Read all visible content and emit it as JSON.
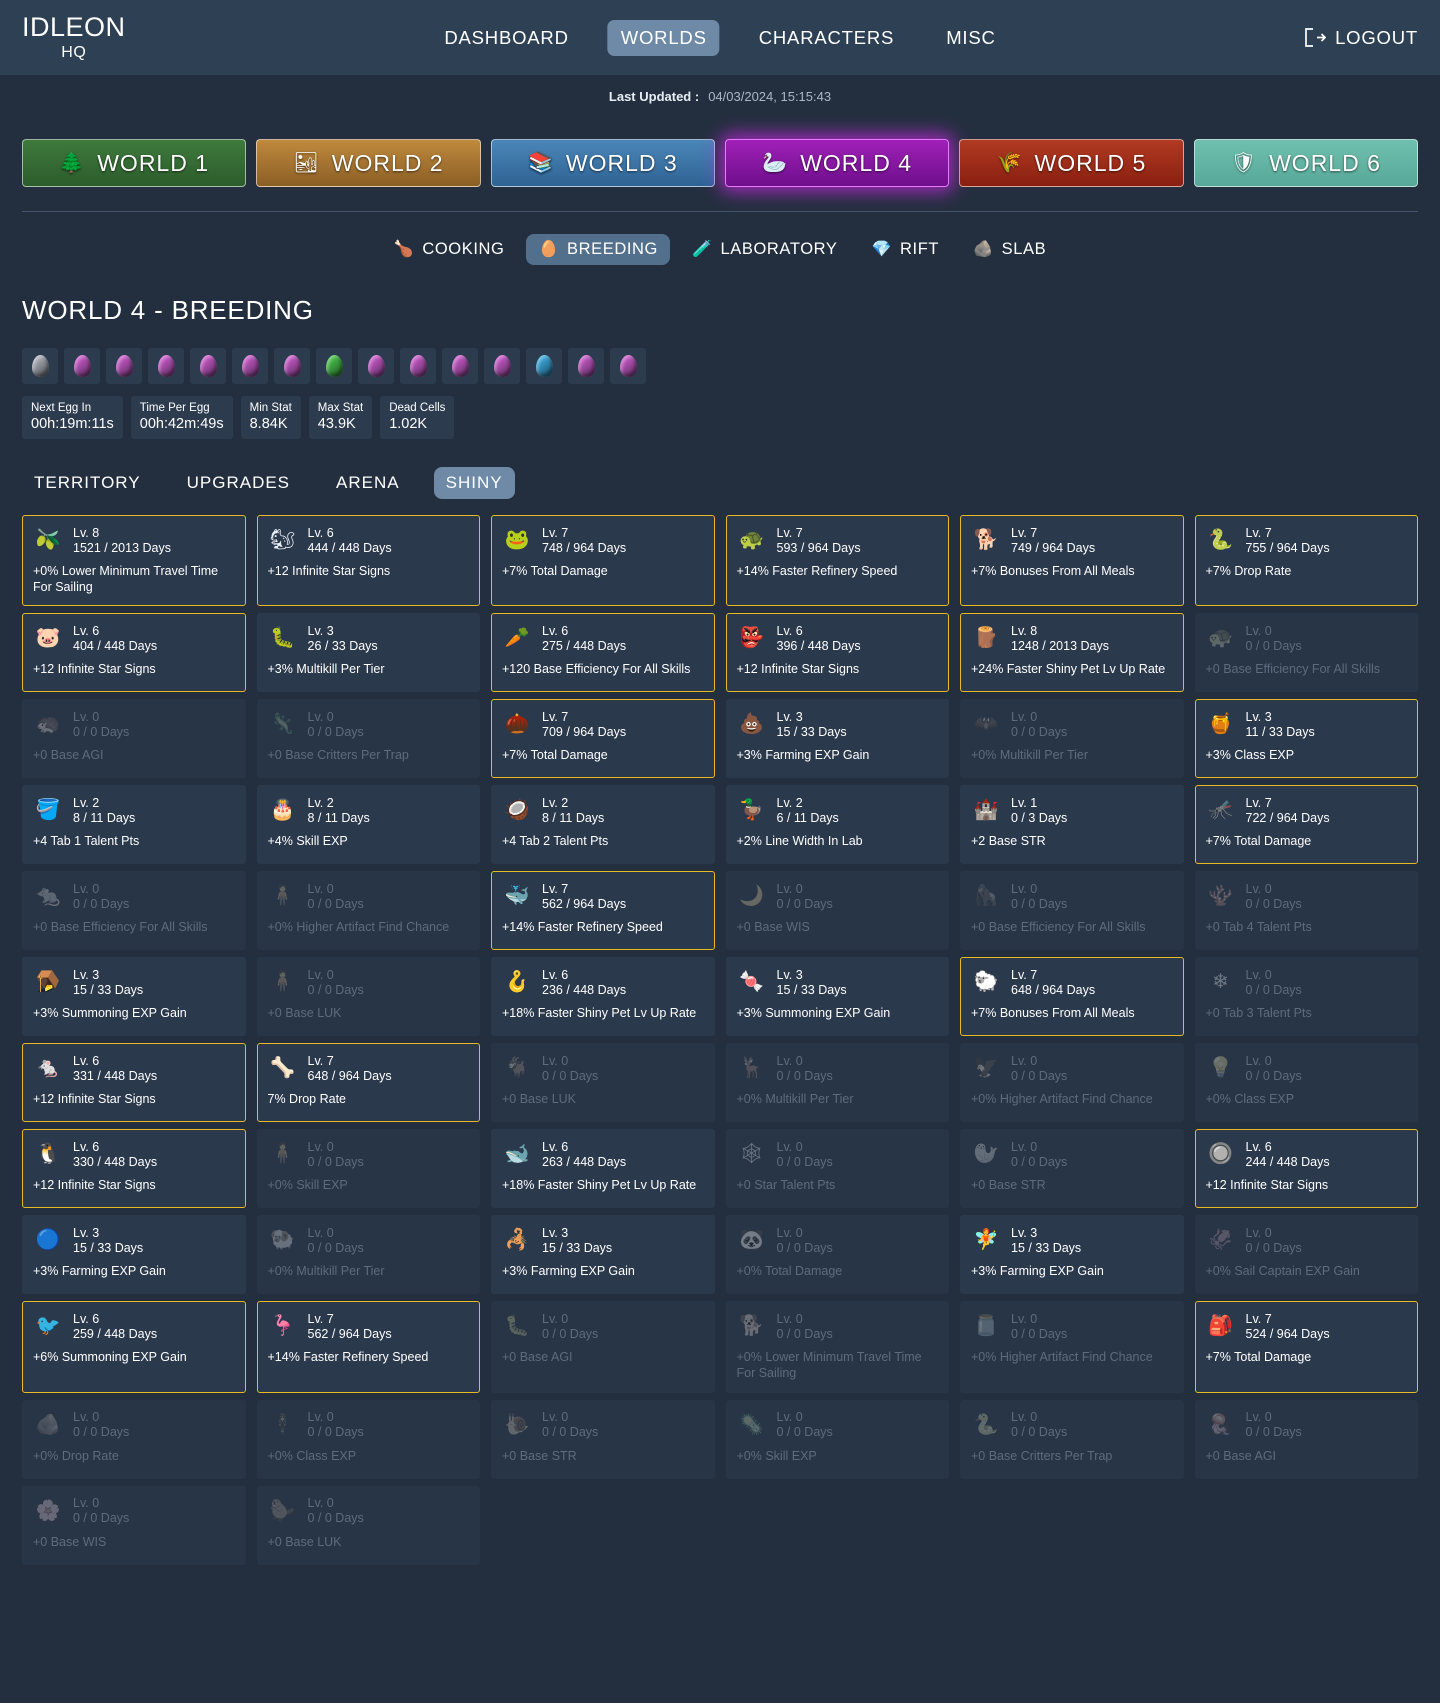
{
  "brand": {
    "main": "IDLEON",
    "sub": "HQ"
  },
  "nav": {
    "items": [
      {
        "label": "DASHBOARD",
        "active": false
      },
      {
        "label": "WORLDS",
        "active": true
      },
      {
        "label": "CHARACTERS",
        "active": false
      },
      {
        "label": "MISC",
        "active": false
      }
    ],
    "logout": "LOGOUT"
  },
  "updated": {
    "label": "Last Updated :",
    "value": "04/03/2024, 15:15:43"
  },
  "worlds": [
    {
      "label": "WORLD 1",
      "icon": "🌲",
      "cls": "w1",
      "active": false
    },
    {
      "label": "WORLD 2",
      "icon": "🏜",
      "cls": "w2",
      "active": false
    },
    {
      "label": "WORLD 3",
      "icon": "📚",
      "cls": "w3",
      "active": false
    },
    {
      "label": "WORLD 4",
      "icon": "🦢",
      "cls": "w4",
      "active": true
    },
    {
      "label": "WORLD 5",
      "icon": "🌾",
      "cls": "w5",
      "active": false
    },
    {
      "label": "WORLD 6",
      "icon": "🛡",
      "cls": "w6",
      "active": false
    }
  ],
  "subtabs": [
    {
      "label": "COOKING",
      "icon": "🍗",
      "active": false
    },
    {
      "label": "BREEDING",
      "icon": "🥚",
      "active": true
    },
    {
      "label": "LABORATORY",
      "icon": "🧪",
      "active": false
    },
    {
      "label": "RIFT",
      "icon": "💎",
      "active": false
    },
    {
      "label": "SLAB",
      "icon": "🪨",
      "active": false
    }
  ],
  "page_title": "WORLD 4 - BREEDING",
  "eggs": [
    "🥚",
    "🥚",
    "🥚",
    "🥚",
    "🥚",
    "🥚",
    "🥚",
    "🥚",
    "🥚",
    "🥚",
    "🥚",
    "🥚",
    "🥚",
    "🥚",
    "🥚"
  ],
  "egg_colors": [
    "#b9bec6",
    "#d85fd8",
    "#d85fd8",
    "#d85fd8",
    "#d85fd8",
    "#d85fd8",
    "#d85fd8",
    "#4ad04a",
    "#d85fd8",
    "#d85fd8",
    "#d85fd8",
    "#d85fd8",
    "#3fb6ef",
    "#d85fd8",
    "#d85fd8"
  ],
  "stats": [
    {
      "label": "Next Egg In",
      "value": "00h:19m:11s"
    },
    {
      "label": "Time Per Egg",
      "value": "00h:42m:49s"
    },
    {
      "label": "Min Stat",
      "value": "8.84K"
    },
    {
      "label": "Max Stat",
      "value": "43.9K"
    },
    {
      "label": "Dead Cells",
      "value": "1.02K"
    }
  ],
  "section_tabs": [
    {
      "label": "TERRITORY",
      "active": false
    },
    {
      "label": "UPGRADES",
      "active": false
    },
    {
      "label": "ARENA",
      "active": false
    },
    {
      "label": "SHINY",
      "active": true
    }
  ],
  "pets": [
    {
      "icon": "🫒",
      "lv": "Lv. 8",
      "days": "1521 / 2013 Days",
      "bonus": "+0% Lower Minimum Travel Time For Sailing",
      "gold": true,
      "locked": false
    },
    {
      "icon": "🐿",
      "lv": "Lv. 6",
      "days": "444 / 448 Days",
      "bonus": "+12 Infinite Star Signs",
      "gold": true,
      "locked": false
    },
    {
      "icon": "🐸",
      "lv": "Lv. 7",
      "days": "748 / 964 Days",
      "bonus": "+7% Total Damage",
      "gold": true,
      "locked": false
    },
    {
      "icon": "🐢",
      "lv": "Lv. 7",
      "days": "593 / 964 Days",
      "bonus": "+14% Faster Refinery Speed",
      "gold": true,
      "locked": false
    },
    {
      "icon": "🐕",
      "lv": "Lv. 7",
      "days": "749 / 964 Days",
      "bonus": "+7% Bonuses From All Meals",
      "gold": true,
      "locked": false
    },
    {
      "icon": "🐍",
      "lv": "Lv. 7",
      "days": "755 / 964 Days",
      "bonus": "+7% Drop Rate",
      "gold": true,
      "locked": false
    },
    {
      "icon": "🐷",
      "lv": "Lv. 6",
      "days": "404 / 448 Days",
      "bonus": "+12 Infinite Star Signs",
      "gold": true,
      "locked": false
    },
    {
      "icon": "🐛",
      "lv": "Lv. 3",
      "days": "26 / 33 Days",
      "bonus": "+3% Multikill Per Tier",
      "gold": false,
      "locked": false
    },
    {
      "icon": "🥕",
      "lv": "Lv. 6",
      "days": "275 / 448 Days",
      "bonus": "+120 Base Efficiency For All Skills",
      "gold": true,
      "locked": false
    },
    {
      "icon": "👺",
      "lv": "Lv. 6",
      "days": "396 / 448 Days",
      "bonus": "+12 Infinite Star Signs",
      "gold": true,
      "locked": false
    },
    {
      "icon": "🪵",
      "lv": "Lv. 8",
      "days": "1248 / 2013 Days",
      "bonus": "+24% Faster Shiny Pet Lv Up Rate",
      "gold": true,
      "locked": false
    },
    {
      "icon": "🐢",
      "lv": "Lv. 0",
      "days": "0 / 0 Days",
      "bonus": "+0 Base Efficiency For All Skills",
      "gold": false,
      "locked": true
    },
    {
      "icon": "🦔",
      "lv": "Lv. 0",
      "days": "0 / 0 Days",
      "bonus": "+0 Base AGI",
      "gold": false,
      "locked": true
    },
    {
      "icon": "🦎",
      "lv": "Lv. 0",
      "days": "0 / 0 Days",
      "bonus": "+0 Base Critters Per Trap",
      "gold": false,
      "locked": true
    },
    {
      "icon": "🌰",
      "lv": "Lv. 7",
      "days": "709 / 964 Days",
      "bonus": "+7% Total Damage",
      "gold": true,
      "locked": false
    },
    {
      "icon": "💩",
      "lv": "Lv. 3",
      "days": "15 / 33 Days",
      "bonus": "+3% Farming EXP Gain",
      "gold": false,
      "locked": false
    },
    {
      "icon": "🦇",
      "lv": "Lv. 0",
      "days": "0 / 0 Days",
      "bonus": "+0% Multikill Per Tier",
      "gold": false,
      "locked": true
    },
    {
      "icon": "🍯",
      "lv": "Lv. 3",
      "days": "11 / 33 Days",
      "bonus": "+3% Class EXP",
      "gold": true,
      "locked": false
    },
    {
      "icon": "🪣",
      "lv": "Lv. 2",
      "days": "8 / 11 Days",
      "bonus": "+4 Tab 1 Talent Pts",
      "gold": false,
      "locked": false
    },
    {
      "icon": "🎂",
      "lv": "Lv. 2",
      "days": "8 / 11 Days",
      "bonus": "+4% Skill EXP",
      "gold": false,
      "locked": false
    },
    {
      "icon": "🥥",
      "lv": "Lv. 2",
      "days": "8 / 11 Days",
      "bonus": "+4 Tab 2 Talent Pts",
      "gold": false,
      "locked": false
    },
    {
      "icon": "🦆",
      "lv": "Lv. 2",
      "days": "6 / 11 Days",
      "bonus": "+2% Line Width In Lab",
      "gold": false,
      "locked": false
    },
    {
      "icon": "🏰",
      "lv": "Lv. 1",
      "days": "0 / 3 Days",
      "bonus": "+2 Base STR",
      "gold": false,
      "locked": false
    },
    {
      "icon": "🦟",
      "lv": "Lv. 7",
      "days": "722 / 964 Days",
      "bonus": "+7% Total Damage",
      "gold": true,
      "locked": false
    },
    {
      "icon": "🐀",
      "lv": "Lv. 0",
      "days": "0 / 0 Days",
      "bonus": "+0 Base Efficiency For All Skills",
      "gold": false,
      "locked": true
    },
    {
      "icon": "🧍",
      "lv": "Lv. 0",
      "days": "0 / 0 Days",
      "bonus": "+0% Higher Artifact Find Chance",
      "gold": false,
      "locked": true
    },
    {
      "icon": "🐳",
      "lv": "Lv. 7",
      "days": "562 / 964 Days",
      "bonus": "+14% Faster Refinery Speed",
      "gold": true,
      "locked": false
    },
    {
      "icon": "🌙",
      "lv": "Lv. 0",
      "days": "0 / 0 Days",
      "bonus": "+0 Base WIS",
      "gold": false,
      "locked": true
    },
    {
      "icon": "🦍",
      "lv": "Lv. 0",
      "days": "0 / 0 Days",
      "bonus": "+0 Base Efficiency For All Skills",
      "gold": false,
      "locked": true
    },
    {
      "icon": "🪸",
      "lv": "Lv. 0",
      "days": "0 / 0 Days",
      "bonus": "+0 Tab 4 Talent Pts",
      "gold": false,
      "locked": true
    },
    {
      "icon": "🪤",
      "lv": "Lv. 3",
      "days": "15 / 33 Days",
      "bonus": "+3% Summoning EXP Gain",
      "gold": false,
      "locked": false
    },
    {
      "icon": "🧍",
      "lv": "Lv. 0",
      "days": "0 / 0 Days",
      "bonus": "+0 Base LUK",
      "gold": false,
      "locked": true
    },
    {
      "icon": "🪝",
      "lv": "Lv. 6",
      "days": "236 / 448 Days",
      "bonus": "+18% Faster Shiny Pet Lv Up Rate",
      "gold": false,
      "locked": false
    },
    {
      "icon": "🍬",
      "lv": "Lv. 3",
      "days": "15 / 33 Days",
      "bonus": "+3% Summoning EXP Gain",
      "gold": false,
      "locked": false
    },
    {
      "icon": "🐑",
      "lv": "Lv. 7",
      "days": "648 / 964 Days",
      "bonus": "+7% Bonuses From All Meals",
      "gold": true,
      "locked": false
    },
    {
      "icon": "❄",
      "lv": "Lv. 0",
      "days": "0 / 0 Days",
      "bonus": "+0 Tab 3 Talent Pts",
      "gold": false,
      "locked": true
    },
    {
      "icon": "🐁",
      "lv": "Lv. 6",
      "days": "331 / 448 Days",
      "bonus": "+12 Infinite Star Signs",
      "gold": true,
      "locked": false
    },
    {
      "icon": "🦴",
      "lv": "Lv. 7",
      "days": "648 / 964 Days",
      "bonus": "7% Drop Rate",
      "gold": true,
      "locked": false
    },
    {
      "icon": "🐐",
      "lv": "Lv. 0",
      "days": "0 / 0 Days",
      "bonus": "+0 Base LUK",
      "gold": false,
      "locked": true
    },
    {
      "icon": "🦌",
      "lv": "Lv. 0",
      "days": "0 / 0 Days",
      "bonus": "+0% Multikill Per Tier",
      "gold": false,
      "locked": true
    },
    {
      "icon": "🦅",
      "lv": "Lv. 0",
      "days": "0 / 0 Days",
      "bonus": "+0% Higher Artifact Find Chance",
      "gold": false,
      "locked": true
    },
    {
      "icon": "💡",
      "lv": "Lv. 0",
      "days": "0 / 0 Days",
      "bonus": "+0% Class EXP",
      "gold": false,
      "locked": true
    },
    {
      "icon": "🐧",
      "lv": "Lv. 6",
      "days": "330 / 448 Days",
      "bonus": "+12 Infinite Star Signs",
      "gold": true,
      "locked": false
    },
    {
      "icon": "🧍",
      "lv": "Lv. 0",
      "days": "0 / 0 Days",
      "bonus": "+0% Skill EXP",
      "gold": false,
      "locked": true
    },
    {
      "icon": "🐋",
      "lv": "Lv. 6",
      "days": "263 / 448 Days",
      "bonus": "+18% Faster Shiny Pet Lv Up Rate",
      "gold": false,
      "locked": false
    },
    {
      "icon": "🕸",
      "lv": "Lv. 0",
      "days": "0 / 0 Days",
      "bonus": "+0 Star Talent Pts",
      "gold": false,
      "locked": true
    },
    {
      "icon": "🦭",
      "lv": "Lv. 0",
      "days": "0 / 0 Days",
      "bonus": "+0 Base STR",
      "gold": false,
      "locked": true
    },
    {
      "icon": "🔘",
      "lv": "Lv. 6",
      "days": "244 / 448 Days",
      "bonus": "+12 Infinite Star Signs",
      "gold": true,
      "locked": false
    },
    {
      "icon": "🔵",
      "lv": "Lv. 3",
      "days": "15 / 33 Days",
      "bonus": "+3% Farming EXP Gain",
      "gold": false,
      "locked": false
    },
    {
      "icon": "🐏",
      "lv": "Lv. 0",
      "days": "0 / 0 Days",
      "bonus": "+0% Multikill Per Tier",
      "gold": false,
      "locked": true
    },
    {
      "icon": "🦂",
      "lv": "Lv. 3",
      "days": "15 / 33 Days",
      "bonus": "+3% Farming EXP Gain",
      "gold": false,
      "locked": false
    },
    {
      "icon": "🐼",
      "lv": "Lv. 0",
      "days": "0 / 0 Days",
      "bonus": "+0% Total Damage",
      "gold": false,
      "locked": true
    },
    {
      "icon": "🧚",
      "lv": "Lv. 3",
      "days": "15 / 33 Days",
      "bonus": "+3% Farming EXP Gain",
      "gold": false,
      "locked": false
    },
    {
      "icon": "🦑",
      "lv": "Lv. 0",
      "days": "0 / 0 Days",
      "bonus": "+0% Sail Captain EXP Gain",
      "gold": false,
      "locked": true
    },
    {
      "icon": "🐦",
      "lv": "Lv. 6",
      "days": "259 / 448 Days",
      "bonus": "+6% Summoning EXP Gain",
      "gold": true,
      "locked": false
    },
    {
      "icon": "🦩",
      "lv": "Lv. 7",
      "days": "562 / 964 Days",
      "bonus": "+14% Faster Refinery Speed",
      "gold": true,
      "locked": false
    },
    {
      "icon": "🐛",
      "lv": "Lv. 0",
      "days": "0 / 0 Days",
      "bonus": "+0 Base AGI",
      "gold": false,
      "locked": true
    },
    {
      "icon": "🐕",
      "lv": "Lv. 0",
      "days": "0 / 0 Days",
      "bonus": "+0% Lower Minimum Travel Time For Sailing",
      "gold": false,
      "locked": true
    },
    {
      "icon": "🫙",
      "lv": "Lv. 0",
      "days": "0 / 0 Days",
      "bonus": "+0% Higher Artifact Find Chance",
      "gold": false,
      "locked": true
    },
    {
      "icon": "🎒",
      "lv": "Lv. 7",
      "days": "524 / 964 Days",
      "bonus": "+7% Total Damage",
      "gold": true,
      "locked": false
    },
    {
      "icon": "🪨",
      "lv": "Lv. 0",
      "days": "0 / 0 Days",
      "bonus": "+0% Drop Rate",
      "gold": false,
      "locked": true
    },
    {
      "icon": "🕴",
      "lv": "Lv. 0",
      "days": "0 / 0 Days",
      "bonus": "+0% Class EXP",
      "gold": false,
      "locked": true
    },
    {
      "icon": "🐌",
      "lv": "Lv. 0",
      "days": "0 / 0 Days",
      "bonus": "+0 Base STR",
      "gold": false,
      "locked": true
    },
    {
      "icon": "🦠",
      "lv": "Lv. 0",
      "days": "0 / 0 Days",
      "bonus": "+0% Skill EXP",
      "gold": false,
      "locked": true
    },
    {
      "icon": "🐍",
      "lv": "Lv. 0",
      "days": "0 / 0 Days",
      "bonus": "+0 Base Critters Per Trap",
      "gold": false,
      "locked": true
    },
    {
      "icon": "🪼",
      "lv": "Lv. 0",
      "days": "0 / 0 Days",
      "bonus": "+0 Base AGI",
      "gold": false,
      "locked": true
    },
    {
      "icon": "🌸",
      "lv": "Lv. 0",
      "days": "0 / 0 Days",
      "bonus": "+0 Base WIS",
      "gold": false,
      "locked": true
    },
    {
      "icon": "🦫",
      "lv": "Lv. 0",
      "days": "0 / 0 Days",
      "bonus": "+0 Base LUK",
      "gold": false,
      "locked": true
    }
  ]
}
